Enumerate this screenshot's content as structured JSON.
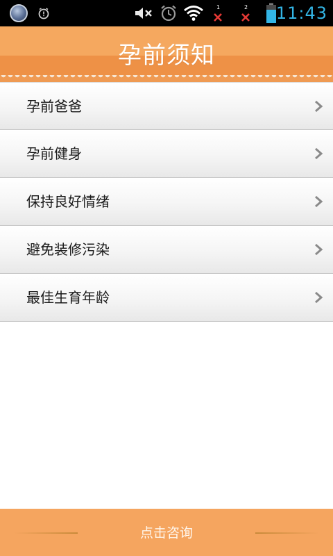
{
  "status_bar": {
    "time": "11:43",
    "sim1": "1",
    "sim2": "2",
    "icons": [
      "app-badge-icon",
      "alarm-icon",
      "mute-icon",
      "alarm-clock-icon",
      "wifi-icon",
      "no-signal-icon",
      "no-signal-icon",
      "battery-icon"
    ]
  },
  "header": {
    "title": "孕前须知"
  },
  "list": {
    "items": [
      {
        "label": "孕前爸爸"
      },
      {
        "label": "孕前健身"
      },
      {
        "label": "保持良好情绪"
      },
      {
        "label": "避免装修污染"
      },
      {
        "label": "最佳生育年龄"
      }
    ]
  },
  "bottom_bar": {
    "consult_label": "点击咨询"
  },
  "colors": {
    "accent": "#f5a55f",
    "status_time": "#33b5e5",
    "no_signal": "#e53935",
    "battery": "#33b5e5"
  }
}
